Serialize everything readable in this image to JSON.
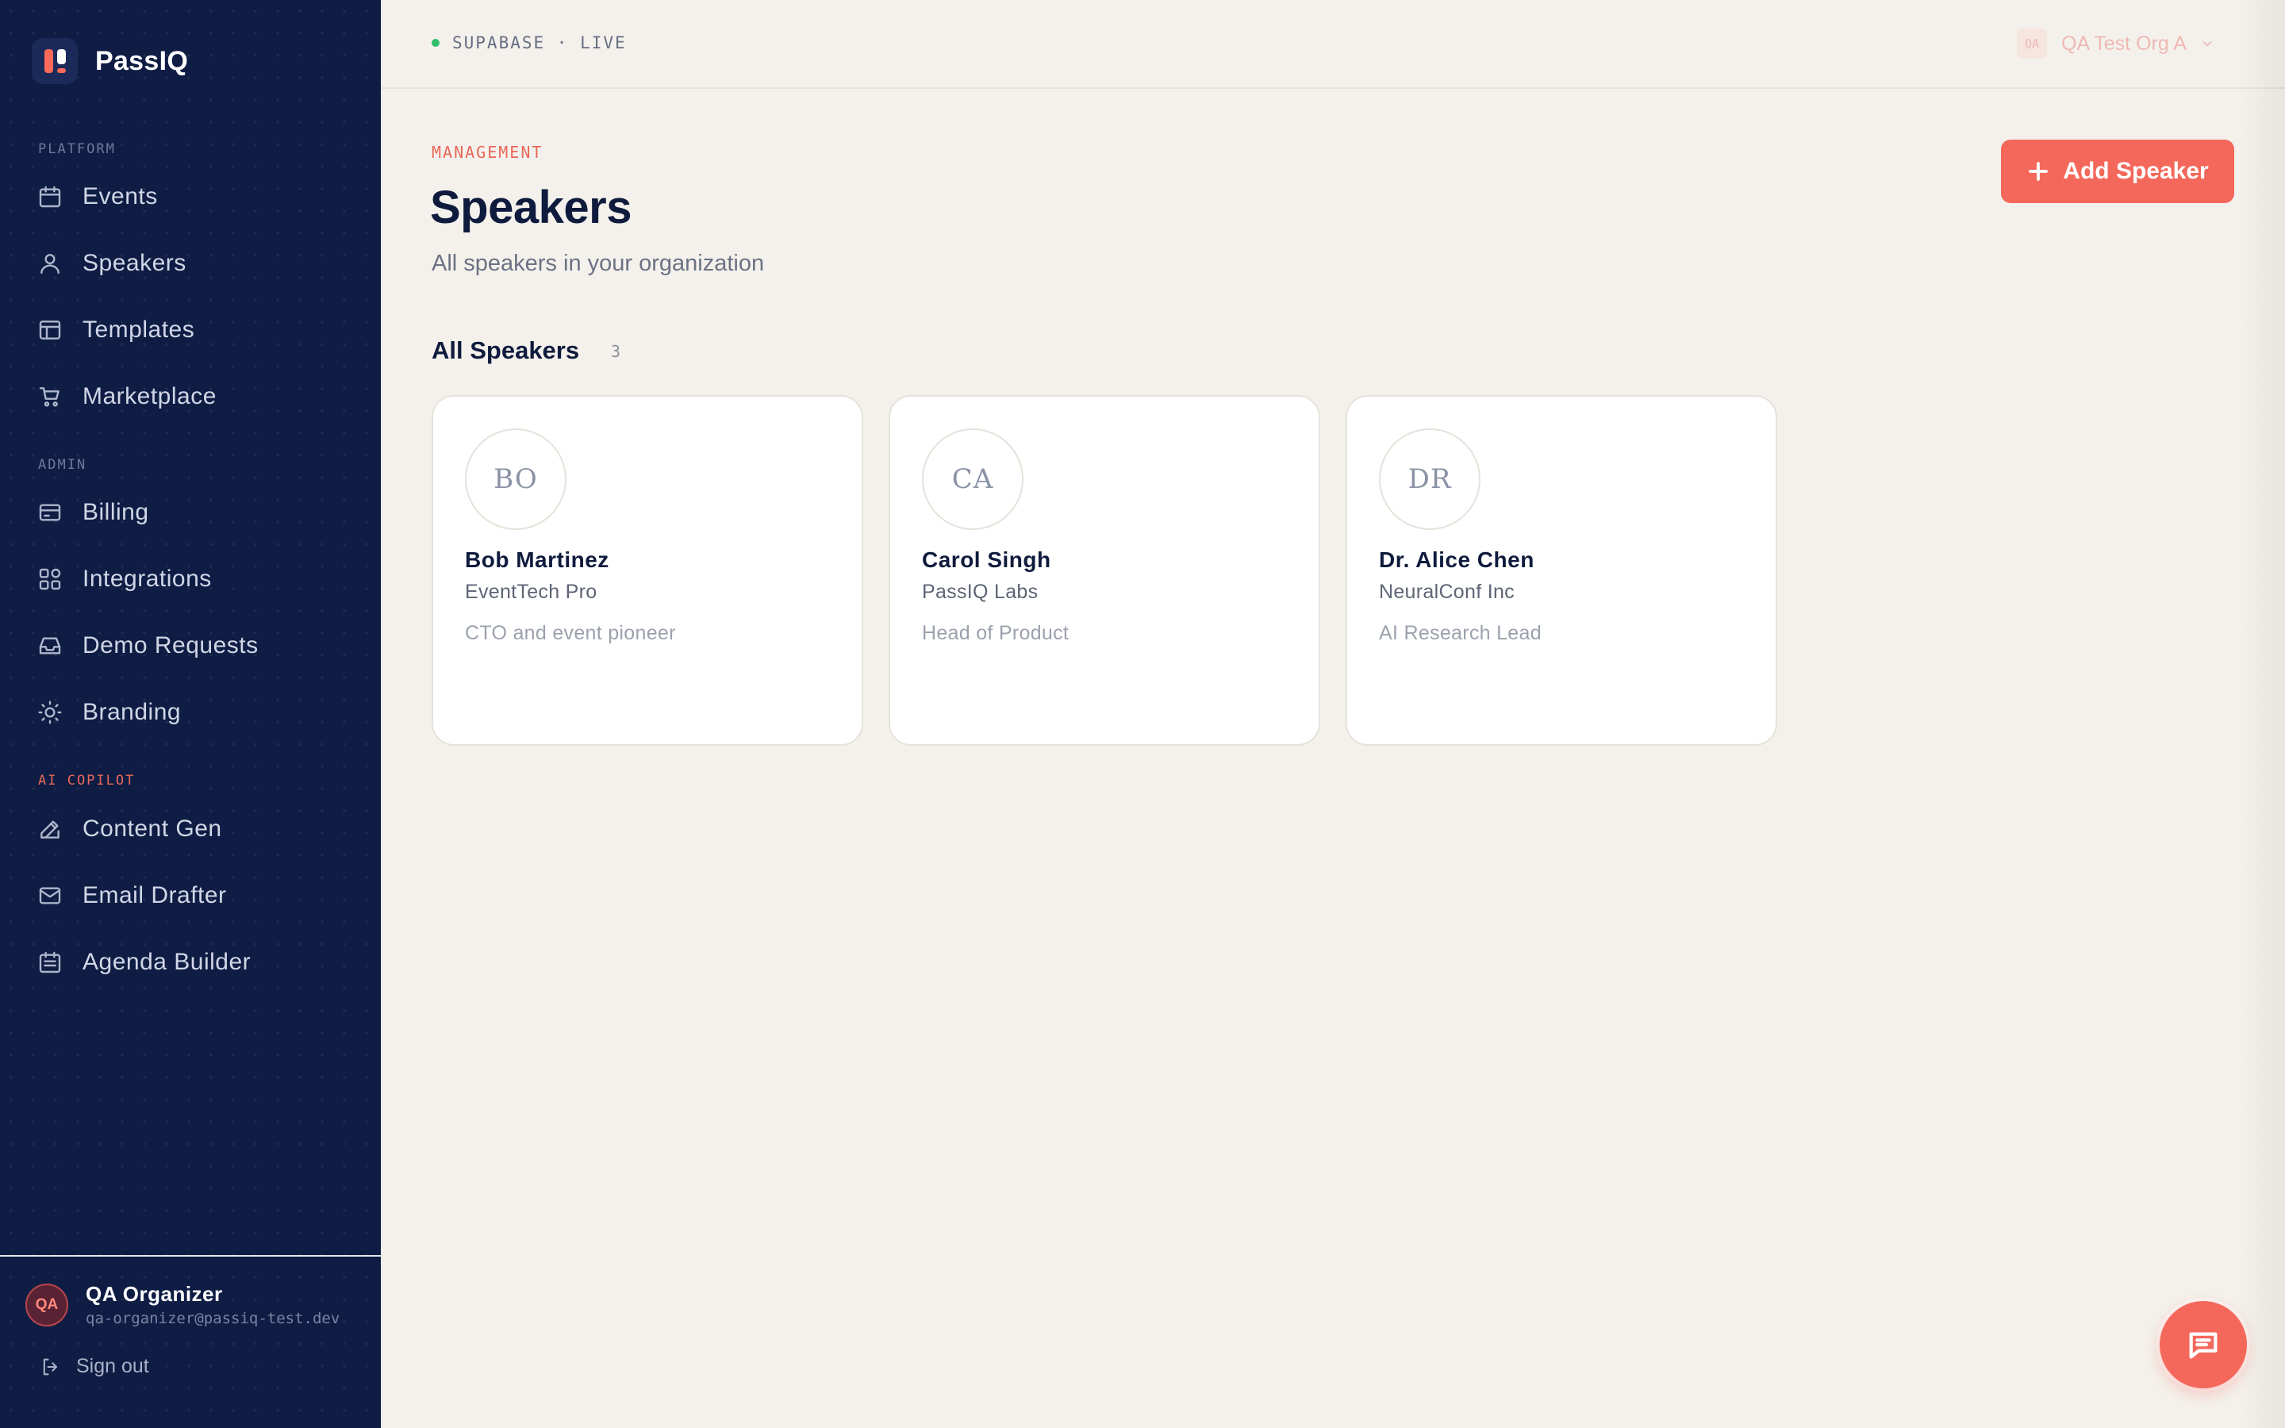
{
  "app": {
    "name": "PassIQ"
  },
  "sidebar": {
    "sections": [
      {
        "label": "PLATFORM",
        "items": [
          {
            "label": "Events",
            "icon": "calendar-icon"
          },
          {
            "label": "Speakers",
            "icon": "user-icon"
          },
          {
            "label": "Templates",
            "icon": "layout-icon"
          },
          {
            "label": "Marketplace",
            "icon": "cart-icon"
          }
        ]
      },
      {
        "label": "ADMIN",
        "items": [
          {
            "label": "Billing",
            "icon": "credit-card-icon"
          },
          {
            "label": "Integrations",
            "icon": "grid-icon"
          },
          {
            "label": "Demo Requests",
            "icon": "inbox-icon"
          },
          {
            "label": "Branding",
            "icon": "sun-icon"
          }
        ]
      },
      {
        "label": "AI COPILOT",
        "items": [
          {
            "label": "Content Gen",
            "icon": "edit-icon"
          },
          {
            "label": "Email Drafter",
            "icon": "mail-icon"
          },
          {
            "label": "Agenda Builder",
            "icon": "calendar-list-icon"
          }
        ]
      }
    ],
    "user": {
      "initials": "QA",
      "name": "QA Organizer",
      "email": "qa-organizer@passiq-test.dev"
    },
    "signout_label": "Sign out"
  },
  "topbar": {
    "status": "SUPABASE · LIVE",
    "org": {
      "badge": "QA",
      "name": "QA Test Org A"
    }
  },
  "main": {
    "eyebrow": "MANAGEMENT",
    "title": "Speakers",
    "subtitle": "All speakers in your organization",
    "add_button_label": "Add Speaker",
    "list_title": "All Speakers",
    "list_count": "3",
    "speakers": [
      {
        "initials": "BO",
        "name": "Bob Martinez",
        "company": "EventTech Pro",
        "bio": "CTO and event pioneer"
      },
      {
        "initials": "CA",
        "name": "Carol Singh",
        "company": "PassIQ Labs",
        "bio": "Head of Product"
      },
      {
        "initials": "DR",
        "name": "Dr. Alice Chen",
        "company": "NeuralConf Inc",
        "bio": "AI Research Lead"
      }
    ]
  },
  "colors": {
    "accent": "#f4685b",
    "sidebar_bg": "#0f1d44",
    "page_bg": "#f4f1ec",
    "status_live": "#2fbf6a"
  }
}
